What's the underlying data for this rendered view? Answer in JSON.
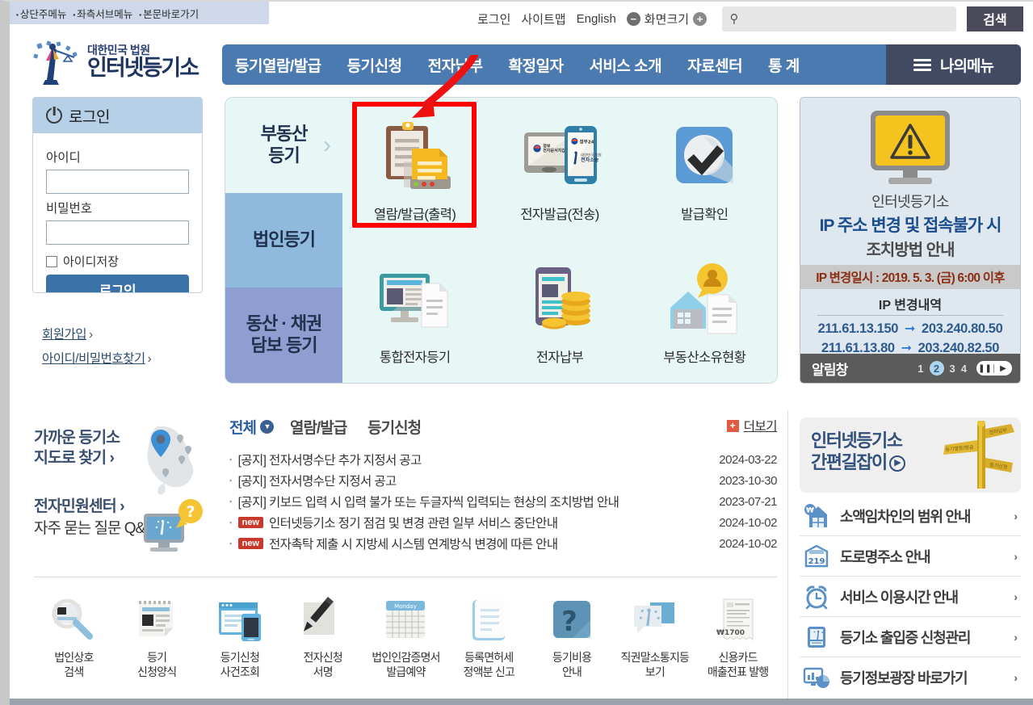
{
  "skip_links": [
    "상단주메뉴",
    "좌측서브메뉴",
    "본문바로가기"
  ],
  "utility_nav": {
    "login": "로그인",
    "sitemap": "사이트맵",
    "english": "English",
    "zoom_label": "화면크기",
    "zoom_out_icon": "minus-circle-icon",
    "zoom_in_icon": "plus-circle-icon",
    "search_placeholder": "",
    "search_value": "",
    "search_button": "검색",
    "search_icon": "search-icon"
  },
  "logo": {
    "line1": "대한민국 법원",
    "line2": "인터넷등기소",
    "mark": "court-scales-icon"
  },
  "main_nav": {
    "items": [
      "등기열람/발급",
      "등기신청",
      "전자납부",
      "확정일자",
      "서비스 소개",
      "자료센터",
      "통 계"
    ],
    "mymenu": "나의메뉴",
    "mymenu_icon": "hamburger-icon",
    "bg_color": "#4a7ab0",
    "mymenu_bg": "#424a63"
  },
  "login_box": {
    "title": "로그인",
    "power_icon": "power-icon",
    "id_label": "아이디",
    "id_value": "",
    "pw_label": "비밀번호",
    "pw_value": "",
    "save_id_label": "아이디저장",
    "save_id_checked": false,
    "login_button": "로그인",
    "links": [
      "회원가입",
      "아이디/비밀번호찾기"
    ]
  },
  "service_panel": {
    "categories": [
      {
        "label": "부동산\n등기",
        "active": true,
        "color": "#e6f7f5"
      },
      {
        "label": "법인등기",
        "active": false,
        "color": "#8fbadd"
      },
      {
        "label": "동산 · 채권\n담보 등기",
        "active": false,
        "color": "#8f9ed0"
      }
    ],
    "tiles": [
      {
        "label": "열람/발급(출력)",
        "icon": "clipboard-document-icon",
        "highlighted": true
      },
      {
        "label": "전자발급(전송)",
        "icon": "tablet-phone-icon",
        "highlighted": false
      },
      {
        "label": "발급확인",
        "icon": "checkmark-badge-icon",
        "highlighted": false
      },
      {
        "label": "통합전자등기",
        "icon": "monitor-document-icon",
        "highlighted": false
      },
      {
        "label": "전자납부",
        "icon": "phone-coins-icon",
        "highlighted": false
      },
      {
        "label": "부동산소유현황",
        "icon": "house-person-document-icon",
        "highlighted": false
      }
    ],
    "annotation": {
      "box_color": "#ff0000",
      "arrow_color": "#ee1111",
      "target": "열람/발급(출력)"
    }
  },
  "banner": {
    "warning_icon": "monitor-warning-icon",
    "title_small": "인터넷등기소",
    "title_main": "IP 주소 변경 및 접속불가 시",
    "title_sub": "조치방법 안내",
    "ip_date": "IP 변경일시 : 2019. 5. 3. (금) 6:00 이후",
    "ip_heading": "IP 변경내역",
    "ip_rows": [
      {
        "from": "211.61.13.150",
        "to": "203.240.80.50"
      },
      {
        "from": "211.61.13.80",
        "to": "203.240.82.50"
      }
    ],
    "bottom_label": "알림창",
    "pages": [
      "1",
      "2",
      "3",
      "4"
    ],
    "active_page": "2",
    "pause_icon": "pause-icon",
    "next_icon": "next-icon"
  },
  "sidebar_promos": {
    "map": {
      "line1": "가까운 등기소",
      "line2": "지도로 찾기",
      "icon": "korea-map-pin-icon"
    },
    "qna": {
      "line1": "전자민원센터",
      "line2": "자주 묻는 질문\nQ&A",
      "icon": "monitor-question-icon"
    }
  },
  "notices": {
    "tabs": [
      {
        "label": "전체",
        "active": true,
        "has_dropdown": true
      },
      {
        "label": "열람/발급",
        "active": false,
        "has_dropdown": false
      },
      {
        "label": "등기신청",
        "active": false,
        "has_dropdown": false
      }
    ],
    "more_label": "더보기",
    "more_icon": "plus-square-icon",
    "items": [
      {
        "tag": "",
        "title": "[공지] 전자서명수단 추가 지정서 공고",
        "date": "2024-03-22"
      },
      {
        "tag": "",
        "title": "[공지] 전자서명수단 지정서 공고",
        "date": "2023-10-30"
      },
      {
        "tag": "",
        "title": "[공지] 키보드 입력 시 입력 불가 또는 두글자씩 입력되는 현상의 조치방법 안내",
        "date": "2023-07-21"
      },
      {
        "tag": "new",
        "title": "인터넷등기소 정기 점검 및 변경 관련 일부 서비스 중단안내",
        "date": "2024-10-02"
      },
      {
        "tag": "new",
        "title": "전자촉탁 제출 시 지방세 시스템 연계방식 변경에 따른 안내",
        "date": "2024-10-02"
      }
    ]
  },
  "quick_icons": [
    {
      "label": "법인상호\n검색",
      "icon": "magnifier-document-icon"
    },
    {
      "label": "등기\n신청양식",
      "icon": "form-paper-icon"
    },
    {
      "label": "등기신청\n사건조회",
      "icon": "browser-phone-icon"
    },
    {
      "label": "전자신청\n서명",
      "icon": "pen-signature-icon"
    },
    {
      "label": "법인인감증명서\n발급예약",
      "icon": "calendar-icon"
    },
    {
      "label": "등록면허세\n정액분 신고",
      "icon": "blue-document-icon"
    },
    {
      "label": "등기비용\n안내",
      "icon": "question-mark-icon"
    },
    {
      "label": "직권말소통지등\n보기",
      "icon": "speech-bubble-icon"
    },
    {
      "label": "신용카드\n매출전표 발행",
      "icon": "receipt-icon"
    }
  ],
  "right_rail": {
    "guide": {
      "line1": "인터넷등기소",
      "line2": "간편길잡이",
      "arrow_icon": "circle-arrow-icon",
      "image": "signpost-icon"
    },
    "links": [
      {
        "label": "소액임차인의 범위 안내",
        "icon": "house-won-icon"
      },
      {
        "label": "도로명주소 안내",
        "icon": "address-plate-icon",
        "badge": "219"
      },
      {
        "label": "서비스 이용시간 안내",
        "icon": "alarm-clock-icon"
      },
      {
        "label": "등기소 출입증 신청관리",
        "icon": "id-card-icon"
      },
      {
        "label": "등기정보광장 바로가기",
        "icon": "chart-monitor-icon"
      }
    ],
    "chevron_icon": "chevron-right-icon"
  }
}
